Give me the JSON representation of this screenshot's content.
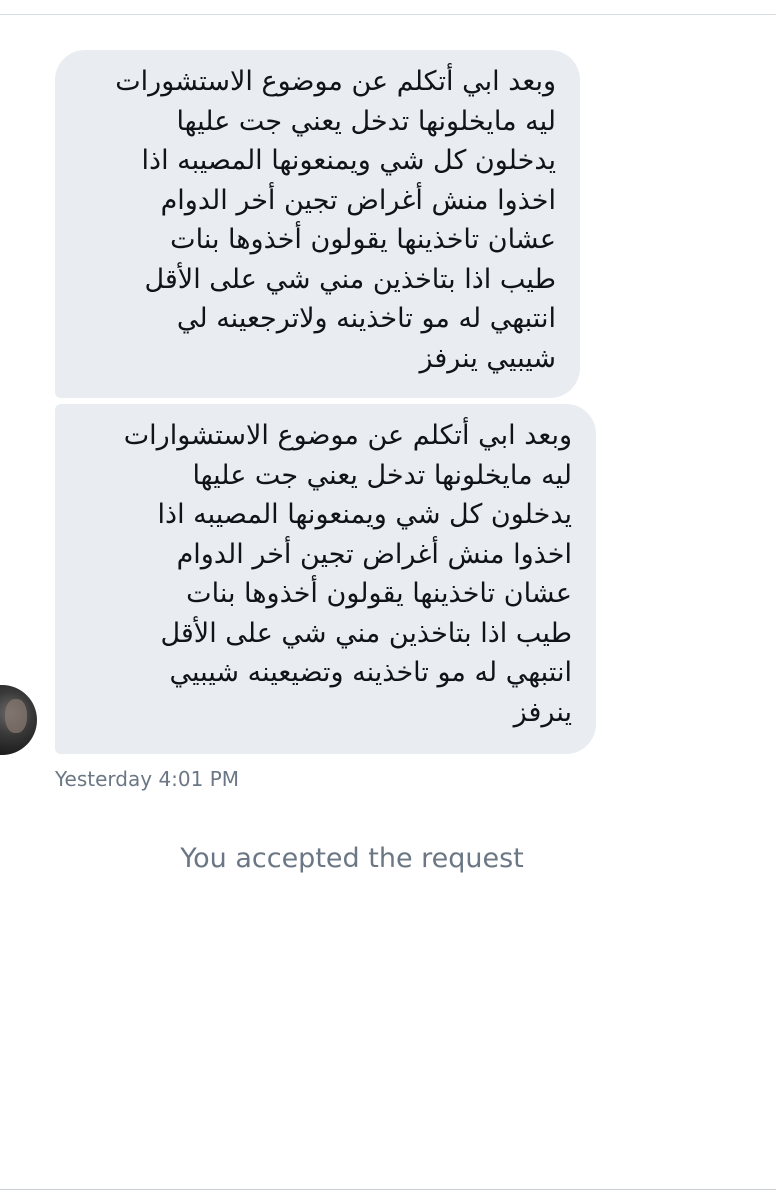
{
  "conversation": {
    "messages": [
      {
        "lines": [
          "وبعد ابي أتكلم عن موضوع الاستشورات",
          "ليه مايخلونها تدخل يعني جت عليها",
          "يدخلون كل شي ويمنعونها المصيبه اذا",
          "اخذوا منش أغراض تجين أخر الدوام",
          "عشان تاخذينها يقولون أخذوها بنات",
          "طيب اذا بتاخذين مني شي على الأقل",
          "انتبهي له مو تاخذينه ولاترجعينه لي",
          "شيبيي ينرفز"
        ]
      },
      {
        "lines": [
          "وبعد ابي أتكلم عن موضوع الاستشوارات",
          "ليه مايخلونها تدخل يعني جت عليها",
          "يدخلون كل شي ويمنعونها المصيبه اذا",
          "اخذوا منش أغراض تجين أخر الدوام",
          "عشان تاخذينها يقولون أخذوها بنات",
          "طيب اذا بتاخذين مني شي على الأقل",
          "انتبهي له مو تاخذينه وتضيعينه شيبيي",
          "ينرفز"
        ]
      }
    ],
    "timestamp": "Yesterday 4:01 PM",
    "system_message": "You accepted the request"
  },
  "avatar": {
    "icon": "user-avatar-photo"
  },
  "colors": {
    "bubble_background": "#e9ecf0",
    "message_text": "#0f1419",
    "secondary_text": "#6b7785",
    "background": "#ffffff"
  }
}
